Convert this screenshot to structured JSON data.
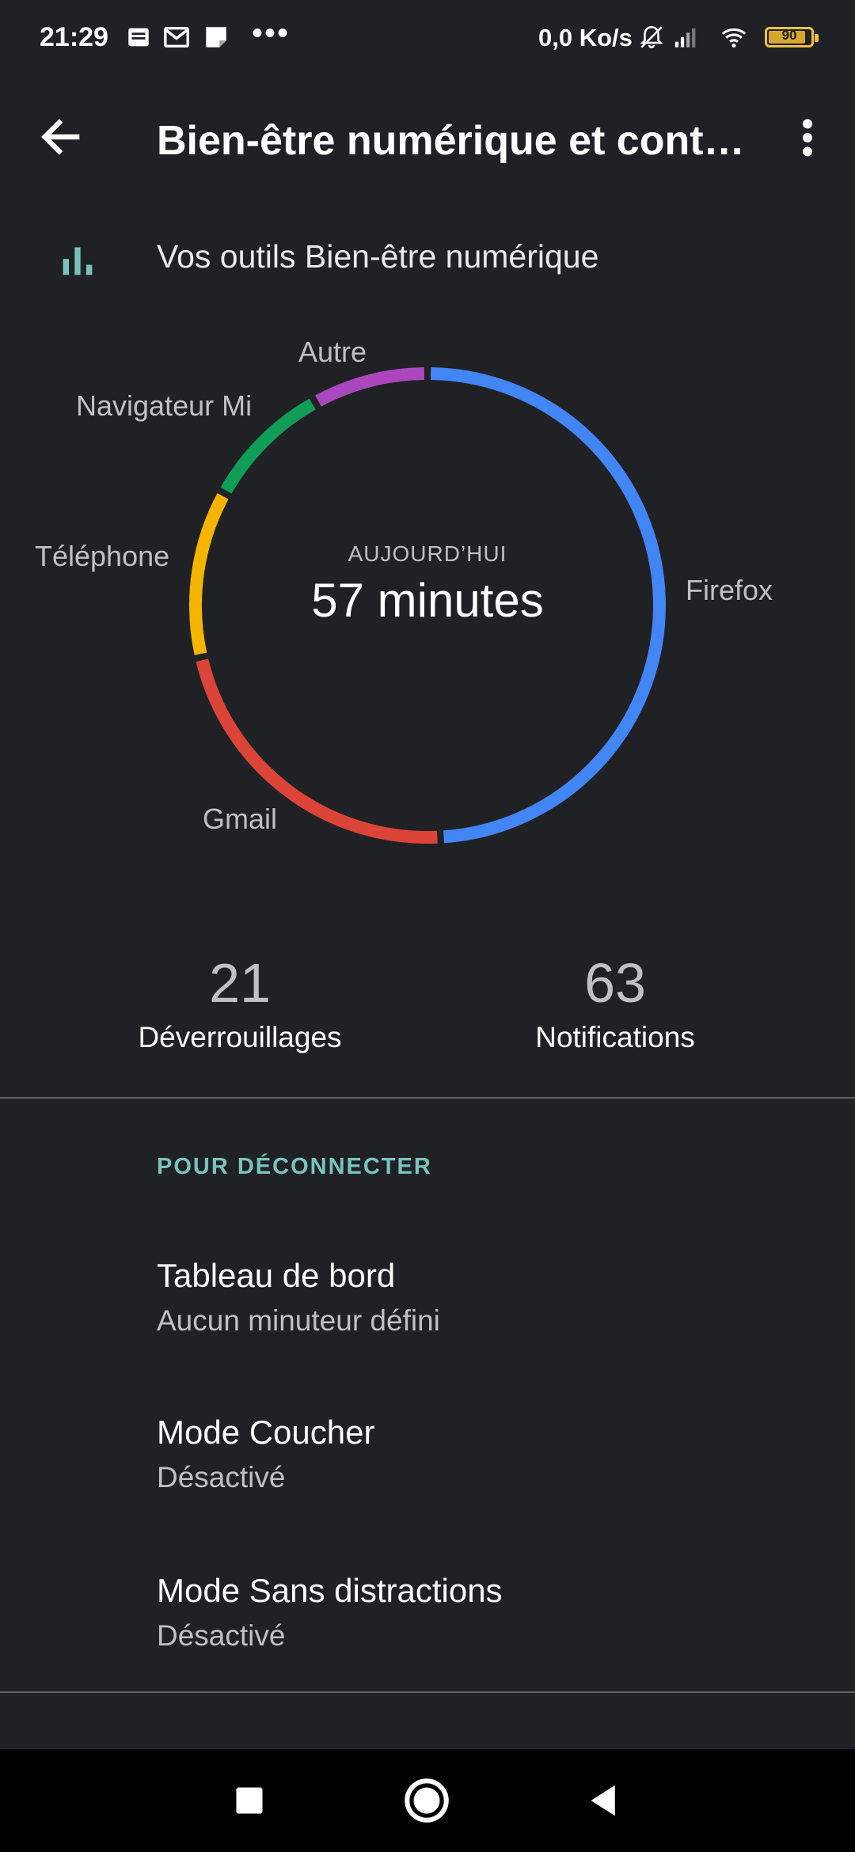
{
  "status_bar": {
    "time": "21:29",
    "net_speed": "0,0 Ko/s",
    "battery_level": "90",
    "battery_fraction": 0.9,
    "icons": [
      "notification-doc-icon",
      "gmail-icon",
      "note-icon",
      "more-icon",
      "bell-off-icon",
      "signal-icon",
      "wifi-icon",
      "battery-icon"
    ]
  },
  "app_bar": {
    "title": "Bien-être numérique et contrôle parental",
    "back_icon": "arrow-back-icon",
    "menu_icon": "more-vert-icon"
  },
  "tools": {
    "label": "Vos outils Bien-être numérique",
    "icon": "bar-chart-icon"
  },
  "chart_data": {
    "type": "pie",
    "center_caption": "AUJOURD’HUI",
    "center_value": "57 minutes",
    "categories": [
      "Firefox",
      "Gmail",
      "Téléphone",
      "Navigateur Mi",
      "Autre"
    ],
    "values": [
      27.5,
      12.5,
      6.5,
      5,
      4.5
    ],
    "colors": [
      "#4285f4",
      "#db4437",
      "#f4b400",
      "#0f9d58",
      "#ab47bc"
    ]
  },
  "stats": {
    "unlocks": {
      "value": "21",
      "label": "Déverrouillages"
    },
    "notifications": {
      "value": "63",
      "label": "Notifications"
    }
  },
  "section": {
    "header": "POUR DÉCONNECTER",
    "items": [
      {
        "title": "Tableau de bord",
        "subtitle": "Aucun minuteur défini"
      },
      {
        "title": "Mode Coucher",
        "subtitle": "Désactivé"
      },
      {
        "title": "Mode Sans distractions",
        "subtitle": "Désactivé"
      }
    ]
  },
  "nav_bar": {
    "icons": [
      "recents-square-icon",
      "home-circle-icon",
      "back-triangle-icon"
    ]
  }
}
